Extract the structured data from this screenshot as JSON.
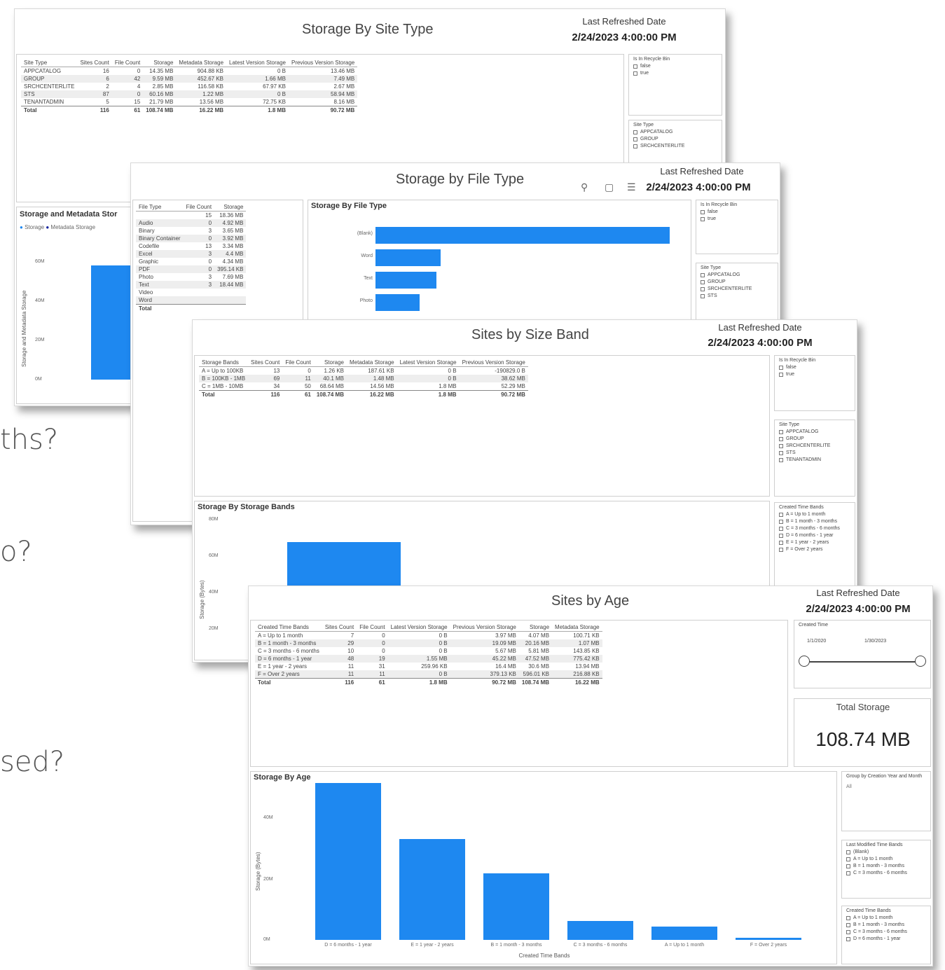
{
  "background_questions": [
    "ths?",
    "o?",
    "sed?"
  ],
  "colors": {
    "bar": "#1e88f0",
    "border": "#d8d8d8"
  },
  "report1": {
    "title": "Storage By Site Type",
    "last_refreshed_label": "Last Refreshed Date",
    "last_refreshed_value": "2/24/2023 4:00:00 PM",
    "table": {
      "headers": [
        "Site Type",
        "Sites Count",
        "File Count",
        "Storage",
        "Metadata Storage",
        "Latest Version Storage",
        "Previous Version Storage"
      ],
      "rows": [
        [
          "APPCATALOG",
          "16",
          "0",
          "14.35 MB",
          "904.88 KB",
          "0 B",
          "13.46 MB"
        ],
        [
          "GROUP",
          "6",
          "42",
          "9.59 MB",
          "452.67 KB",
          "1.66 MB",
          "7.49 MB"
        ],
        [
          "SRCHCENTERLITE",
          "2",
          "4",
          "2.85 MB",
          "116.58 KB",
          "67.97 KB",
          "2.67 MB"
        ],
        [
          "STS",
          "87",
          "0",
          "60.16 MB",
          "1.22 MB",
          "0 B",
          "58.94 MB"
        ],
        [
          "TENANTADMIN",
          "5",
          "15",
          "21.79 MB",
          "13.56 MB",
          "72.75 KB",
          "8.16 MB"
        ]
      ],
      "total": [
        "Total",
        "116",
        "61",
        "108.74 MB",
        "16.22 MB",
        "1.8 MB",
        "90.72 MB"
      ]
    },
    "slicer_recycle": {
      "title": "Is In Recycle Bin",
      "options": [
        "false",
        "true"
      ]
    },
    "slicer_sitetype": {
      "title": "Site Type",
      "options": [
        "APPCATALOG",
        "GROUP",
        "SRCHCENTERLITE"
      ]
    },
    "chart": {
      "title": "Storage and Metadata Stor",
      "legend": [
        "Storage",
        "Metadata Storage"
      ],
      "ylabel": "Storage and Metadata Storage",
      "ticks": [
        "60M",
        "40M",
        "20M",
        "0M"
      ]
    },
    "chart_data": {
      "type": "bar",
      "title": "Storage and Metadata Stor",
      "ylabel": "Storage and Metadata Storage",
      "ylim": [
        0,
        60
      ],
      "series": [
        {
          "name": "Storage",
          "values": [
            57
          ]
        }
      ]
    }
  },
  "report2": {
    "title": "Storage by File Type",
    "last_refreshed_label": "Last Refreshed Date",
    "last_refreshed_value": "2/24/2023 4:00:00 PM",
    "table": {
      "headers": [
        "File Type",
        "File Count",
        "Storage"
      ],
      "rows": [
        [
          "",
          "15",
          "18.36 MB"
        ],
        [
          "Audio",
          "0",
          "4.92 MB"
        ],
        [
          "Binary",
          "3",
          "3.65 MB"
        ],
        [
          "Binary Container",
          "0",
          "3.92 MB"
        ],
        [
          "Codefile",
          "13",
          "3.34 MB"
        ],
        [
          "Excel",
          "3",
          "4.4 MB"
        ],
        [
          "Graphic",
          "0",
          "4.34 MB"
        ],
        [
          "PDF",
          "0",
          "395.14 KB"
        ],
        [
          "Photo",
          "3",
          "7.69 MB"
        ],
        [
          "Text",
          "3",
          "18.44 MB"
        ],
        [
          "Video",
          "",
          ""
        ],
        [
          "Word",
          "",
          ""
        ]
      ],
      "total": [
        "Total",
        "",
        ""
      ]
    },
    "chart": {
      "title": "Storage By File Type",
      "categories": [
        "(Blank)",
        "Word",
        "Text",
        "Photo"
      ]
    },
    "chart_data": {
      "type": "bar",
      "title": "Storage By File Type",
      "categories": [
        "(Blank)",
        "Word",
        "Text",
        "Photo"
      ],
      "values": [
        70,
        15.5,
        14.5,
        10.5
      ]
    },
    "slicer_recycle": {
      "title": "Is In Recycle Bin",
      "options": [
        "false",
        "true"
      ]
    },
    "slicer_sitetype": {
      "title": "Site Type",
      "options": [
        "APPCATALOG",
        "GROUP",
        "SRCHCENTERLITE",
        "STS"
      ]
    }
  },
  "report3": {
    "title": "Sites by Size Band",
    "last_refreshed_label": "Last Refreshed Date",
    "last_refreshed_value": "2/24/2023 4:00:00 PM",
    "table": {
      "headers": [
        "Storage Bands",
        "Sites Count",
        "File Count",
        "Storage",
        "Metadata Storage",
        "Latest Version Storage",
        "Previous Version Storage"
      ],
      "rows": [
        [
          "A = Up to 100KB",
          "13",
          "0",
          "1.26 KB",
          "187.61 KB",
          "0 B",
          "-190829.0 B"
        ],
        [
          "B = 100KB - 1MB",
          "69",
          "11",
          "40.1 MB",
          "1.48 MB",
          "0 B",
          "38.62 MB"
        ],
        [
          "C = 1MB - 10MB",
          "34",
          "50",
          "68.64 MB",
          "14.56 MB",
          "1.8 MB",
          "52.29 MB"
        ]
      ],
      "total": [
        "Total",
        "116",
        "61",
        "108.74 MB",
        "16.22 MB",
        "1.8 MB",
        "90.72 MB"
      ]
    },
    "slicer_recycle": {
      "title": "Is In Recycle Bin",
      "options": [
        "false",
        "true"
      ]
    },
    "slicer_sitetype": {
      "title": "Site Type",
      "options": [
        "APPCATALOG",
        "GROUP",
        "SRCHCENTERLITE",
        "STS",
        "TENANTADMIN"
      ]
    },
    "slicer_created": {
      "title": "Created Time Bands",
      "options": [
        "A = Up to 1 month",
        "B = 1 month - 3 months",
        "C = 3 months - 6 months",
        "D = 6 months - 1 year",
        "E = 1 year - 2 years",
        "F = Over 2 years"
      ]
    },
    "chart": {
      "title": "Storage By Storage Bands",
      "ylabel": "Storage (Bytes)",
      "ticks": [
        "80M",
        "60M",
        "40M",
        "20M"
      ]
    },
    "chart_data": {
      "type": "bar",
      "title": "Storage By Storage Bands",
      "ylabel": "Storage (Bytes)",
      "ylim": [
        0,
        80
      ],
      "values": [
        68.64
      ]
    }
  },
  "report4": {
    "title": "Sites by Age",
    "last_refreshed_label": "Last Refreshed Date",
    "last_refreshed_value": "2/24/2023 4:00:00 PM",
    "table": {
      "headers": [
        "Created Time Bands",
        "Sites Count",
        "File Count",
        "Latest Version Storage",
        "Previous Version Storage",
        "Storage",
        "Metadata Storage"
      ],
      "rows": [
        [
          "A = Up to 1 month",
          "7",
          "0",
          "0 B",
          "3.97 MB",
          "4.07 MB",
          "100.71 KB"
        ],
        [
          "B = 1 month - 3 months",
          "29",
          "0",
          "0 B",
          "19.09 MB",
          "20.16 MB",
          "1.07 MB"
        ],
        [
          "C = 3 months - 6 months",
          "10",
          "0",
          "0 B",
          "5.67 MB",
          "5.81 MB",
          "143.85 KB"
        ],
        [
          "D = 6 months - 1 year",
          "48",
          "19",
          "1.55 MB",
          "45.22 MB",
          "47.52 MB",
          "775.42 KB"
        ],
        [
          "E = 1 year - 2 years",
          "11",
          "31",
          "259.96 KB",
          "16.4 MB",
          "30.6 MB",
          "13.94 MB"
        ],
        [
          "F = Over 2 years",
          "11",
          "11",
          "0 B",
          "379.13 KB",
          "596.01 KB",
          "216.88 KB"
        ]
      ],
      "total": [
        "Total",
        "116",
        "61",
        "1.8 MB",
        "90.72 MB",
        "108.74 MB",
        "16.22 MB"
      ]
    },
    "created_time_slicer": {
      "title": "Created Time",
      "from": "1/1/2020",
      "to": "1/30/2023"
    },
    "total_storage_label": "Total Storage",
    "total_storage_value": "108.74 MB",
    "group_slicer": {
      "title": "Group by Creation Year and Month",
      "value": "All"
    },
    "slicer_modified": {
      "title": "Last Modified Time Bands",
      "options": [
        "(Blank)",
        "A = Up to 1 month",
        "B = 1 month - 3 months",
        "C = 3 months - 6 months"
      ]
    },
    "slicer_created": {
      "title": "Created Time Bands",
      "options": [
        "A = Up to 1 month",
        "B = 1 month - 3 months",
        "C = 3 months - 6 months",
        "D = 6 months - 1 year"
      ]
    },
    "chart": {
      "title": "Storage By Age",
      "ylabel": "Storage (Bytes)",
      "xlabel": "Created Time Bands",
      "ticks": [
        "40M",
        "20M",
        "0M"
      ]
    },
    "chart_data": {
      "type": "bar",
      "title": "Storage By Age",
      "xlabel": "Created Time Bands",
      "ylabel": "Storage (Bytes)",
      "ylim": [
        0,
        50
      ],
      "categories": [
        "D = 6 months - 1 year",
        "E = 1 year - 2 years",
        "B = 1 month - 3 months",
        "C = 3 months - 6 months",
        "A = Up to 1 month",
        "F = Over 2 years"
      ],
      "values": [
        47.52,
        30.6,
        20.16,
        5.81,
        4.07,
        0.6
      ]
    }
  }
}
